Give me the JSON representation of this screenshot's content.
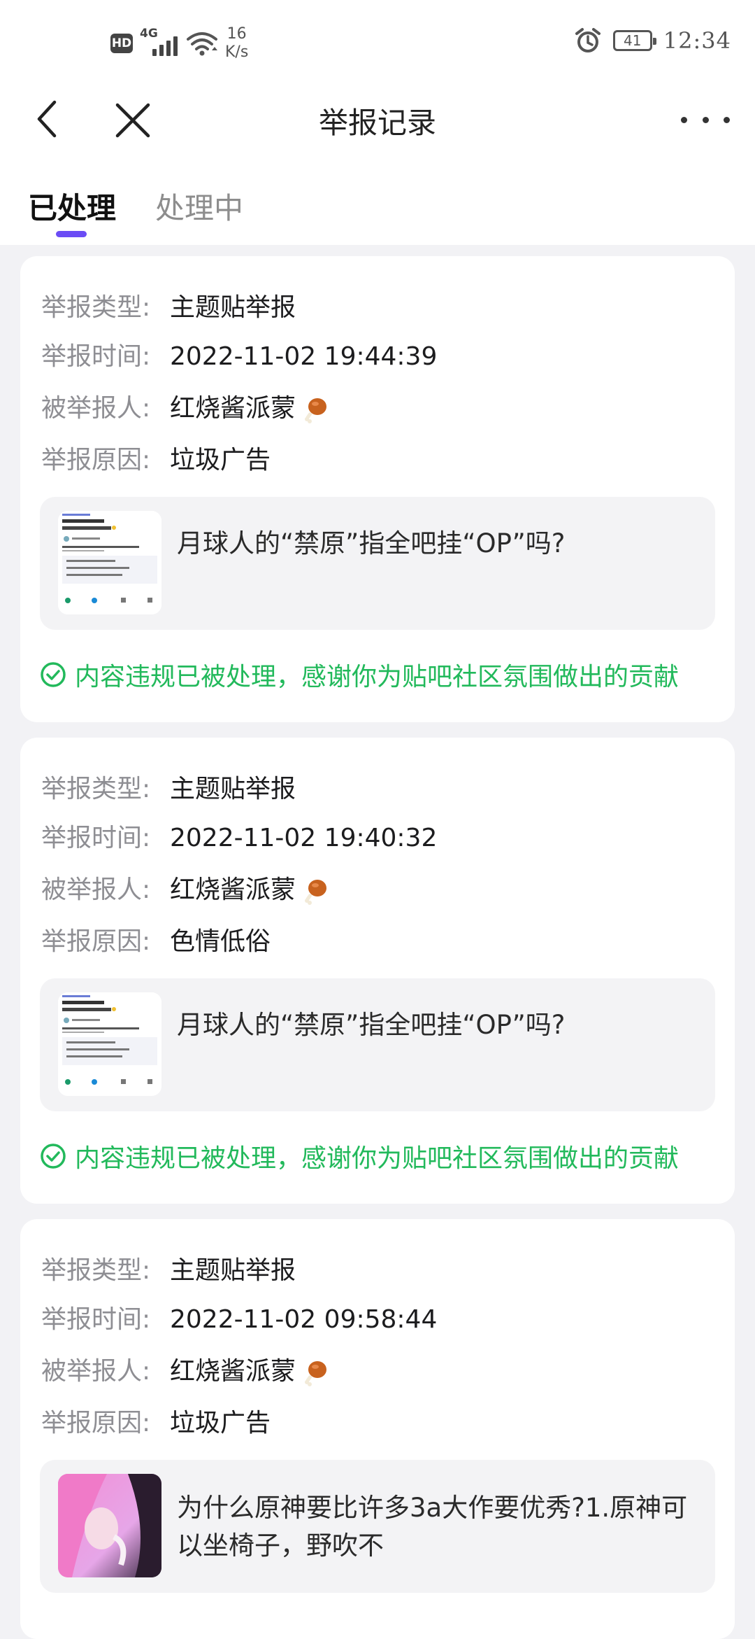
{
  "status_bar": {
    "network": "4G",
    "hd_label": "HD",
    "speed_value": "16",
    "speed_unit": "K/s",
    "battery": "41",
    "time": "12:34"
  },
  "nav": {
    "title": "举报记录"
  },
  "tabs": [
    {
      "label": "已处理"
    },
    {
      "label": "处理中"
    }
  ],
  "labels": {
    "type": "举报类型:",
    "time": "举报时间:",
    "reported_user": "被举报人:",
    "reason": "举报原因:"
  },
  "reports": [
    {
      "type": "主题贴举报",
      "time": "2022-11-02 19:44:39",
      "reported_user": "红烧酱派蒙",
      "reason": "垃圾广告",
      "post_title": "月球人的“禁原”指全吧挂“OP”吗?",
      "status": "内容违规已被处理，感谢你为贴吧社区氛围做出的贡献"
    },
    {
      "type": "主题贴举报",
      "time": "2022-11-02 19:40:32",
      "reported_user": "红烧酱派蒙",
      "reason": "色情低俗",
      "post_title": "月球人的“禁原”指全吧挂“OP”吗?",
      "status": "内容违规已被处理，感谢你为贴吧社区氛围做出的贡献"
    },
    {
      "type": "主题贴举报",
      "time": "2022-11-02 09:58:44",
      "reported_user": "红烧酱派蒙",
      "reason": "垃圾广告",
      "post_title": "为什么原神要比许多3a大作要优秀?1.原神可以坐椅子，野吹不"
    }
  ],
  "colors": {
    "accent": "#6b4cf5",
    "success": "#22b95b"
  }
}
